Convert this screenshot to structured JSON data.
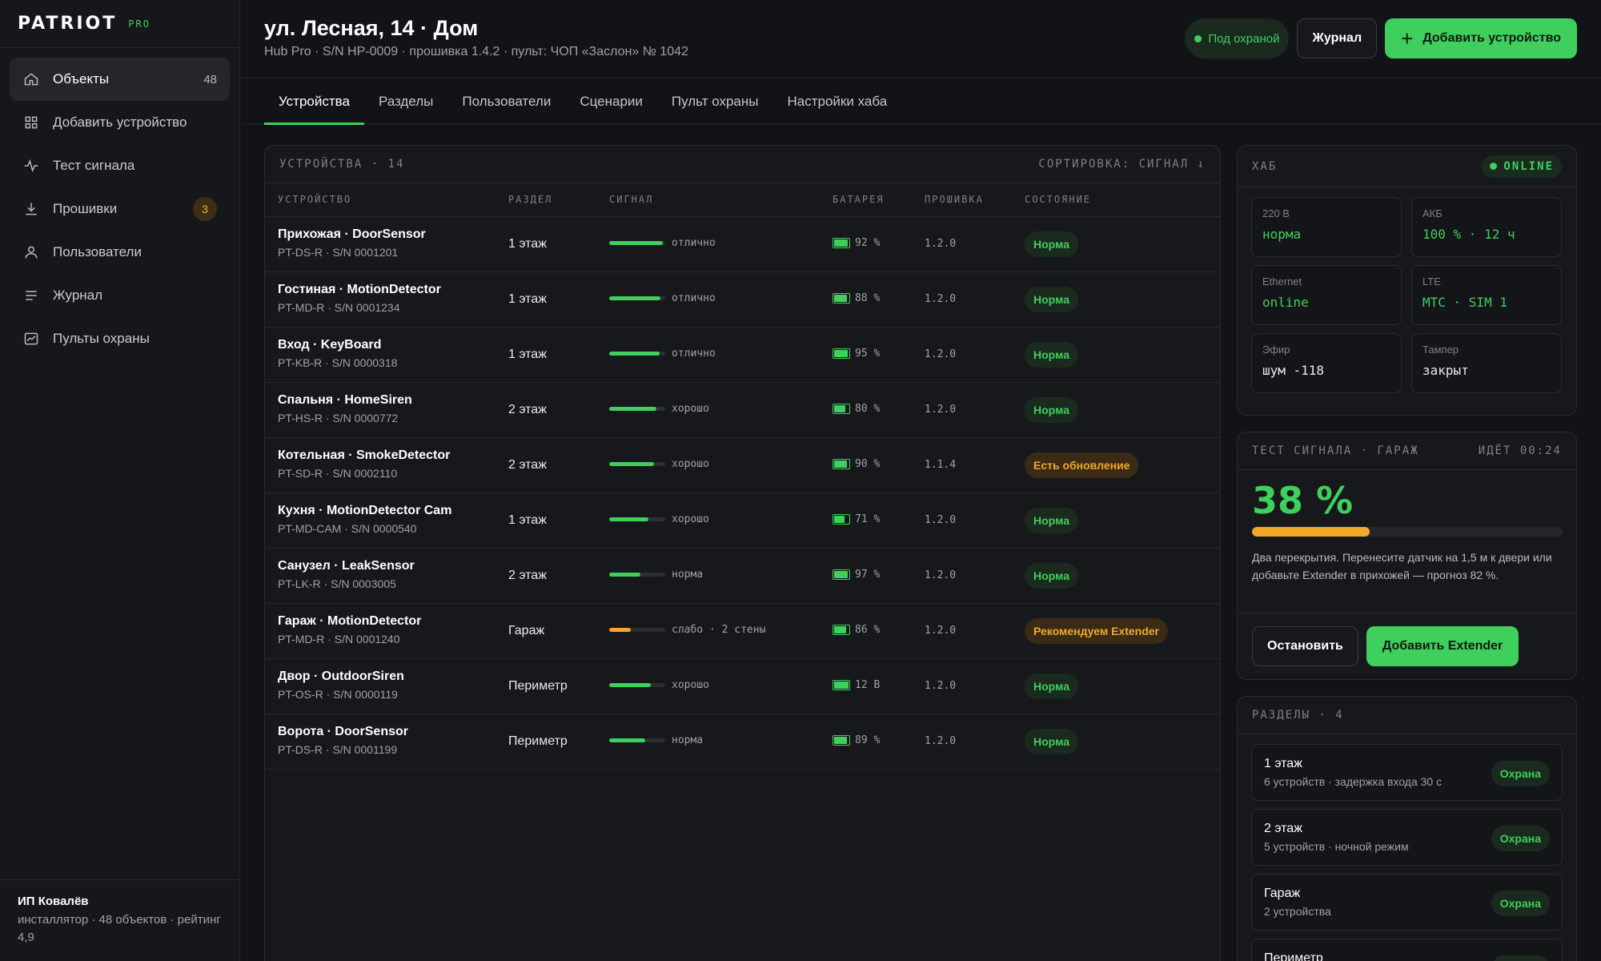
{
  "brand": {
    "name": "PATRIOT",
    "tag": "PRO"
  },
  "sidebar": {
    "items": [
      {
        "label": "Объекты",
        "count": "48",
        "icon": "home-icon"
      },
      {
        "label": "Добавить устройство",
        "icon": "grid-icon"
      },
      {
        "label": "Тест сигнала",
        "icon": "pulse-icon"
      },
      {
        "label": "Прошивки",
        "badge": "3",
        "icon": "download-icon"
      },
      {
        "label": "Пользователи",
        "icon": "user-icon"
      },
      {
        "label": "Журнал",
        "icon": "list-icon"
      },
      {
        "label": "Пульты охраны",
        "icon": "monitor-chart-icon"
      }
    ],
    "footer": {
      "name": "ИП Ковалёв",
      "meta": "инсталлятор · 48 объектов · рейтинг 4,9"
    }
  },
  "header": {
    "title": "ул. Лесная, 14 · Дом",
    "subtitle": "Hub Pro · S/N HP-0009 · прошивка 1.4.2 · пульт: ЧОП «Заслон» № 1042",
    "status": "Под охраной",
    "journal_label": "Журнал",
    "add_label": "Добавить устройство"
  },
  "tabs": [
    "Устройства",
    "Разделы",
    "Пользователи",
    "Сценарии",
    "Пульт охраны",
    "Настройки хаба"
  ],
  "devices": {
    "title": "УСТРОЙСТВА · 14",
    "sort": "СОРТИРОВКА: СИГНАЛ ↓",
    "columns": [
      "УСТРОЙСТВО",
      "РАЗДЕЛ",
      "СИГНАЛ",
      "БАТАРЕЯ",
      "ПРОШИВКА",
      "СОСТОЯНИЕ"
    ],
    "rows": [
      {
        "name": "Прихожая · DoorSensor",
        "sn": "PT-DS-R · S/N 0001201",
        "zone": "1 этаж",
        "signal": 0.96,
        "signal_color": "#3ecf5c",
        "signal_label": "отлично",
        "battery": 0.92,
        "battery_label": "92 %",
        "fw": "1.2.0",
        "state": "Норма",
        "state_kind": "ok"
      },
      {
        "name": "Гостиная · MotionDetector",
        "sn": "PT-MD-R · S/N 0001234",
        "zone": "1 этаж",
        "signal": 0.92,
        "signal_color": "#3ecf5c",
        "signal_label": "отлично",
        "battery": 0.88,
        "battery_label": "88 %",
        "fw": "1.2.0",
        "state": "Норма",
        "state_kind": "ok"
      },
      {
        "name": "Вход · KeyBoard",
        "sn": "PT-KB-R · S/N 0000318",
        "zone": "1 этаж",
        "signal": 0.9,
        "signal_color": "#3ecf5c",
        "signal_label": "отлично",
        "battery": 0.95,
        "battery_label": "95 %",
        "fw": "1.2.0",
        "state": "Норма",
        "state_kind": "ok"
      },
      {
        "name": "Спальня · HomeSiren",
        "sn": "PT-HS-R · S/N 0000772",
        "zone": "2 этаж",
        "signal": 0.84,
        "signal_color": "#3ecf5c",
        "signal_label": "хорошо",
        "battery": 0.8,
        "battery_label": "80 %",
        "fw": "1.2.0",
        "state": "Норма",
        "state_kind": "ok"
      },
      {
        "name": "Котельная · SmokeDetector",
        "sn": "PT-SD-R · S/N 0002110",
        "zone": "2 этаж",
        "signal": 0.8,
        "signal_color": "#3ecf5c",
        "signal_label": "хорошо",
        "battery": 0.9,
        "battery_label": "90 %",
        "fw": "1.1.4",
        "state": "Есть обновление",
        "state_kind": "warn"
      },
      {
        "name": "Кухня · MotionDetector Cam",
        "sn": "PT-MD-CAM · S/N 0000540",
        "zone": "1 этаж",
        "signal": 0.7,
        "signal_color": "#3ecf5c",
        "signal_label": "хорошо",
        "battery": 0.71,
        "battery_label": "71 %",
        "fw": "1.2.0",
        "state": "Норма",
        "state_kind": "ok"
      },
      {
        "name": "Санузел · LeakSensor",
        "sn": "PT-LK-R · S/N 0003005",
        "zone": "2 этаж",
        "signal": 0.56,
        "signal_color": "#3ecf5c",
        "signal_label": "норма",
        "battery": 0.97,
        "battery_label": "97 %",
        "fw": "1.2.0",
        "state": "Норма",
        "state_kind": "ok"
      },
      {
        "name": "Гараж · MotionDetector",
        "sn": "PT-MD-R · S/N 0001240",
        "zone": "Гараж",
        "signal": 0.38,
        "signal_color": "#f0a928",
        "signal_label": "слабо · 2 стены",
        "battery": 0.86,
        "battery_label": "86 %",
        "fw": "1.2.0",
        "state": "Рекомендуем Extender",
        "state_kind": "warn"
      },
      {
        "name": "Двор · OutdoorSiren",
        "sn": "PT-OS-R · S/N 0000119",
        "zone": "Периметр",
        "signal": 0.74,
        "signal_color": "#3ecf5c",
        "signal_label": "хорошо",
        "battery": 1.0,
        "battery_label": "12 В",
        "fw": "1.2.0",
        "state": "Норма",
        "state_kind": "ok"
      },
      {
        "name": "Ворота · DoorSensor",
        "sn": "PT-DS-R · S/N 0001199",
        "zone": "Периметр",
        "signal": 0.64,
        "signal_color": "#3ecf5c",
        "signal_label": "норма",
        "battery": 0.89,
        "battery_label": "89 %",
        "fw": "1.2.0",
        "state": "Норма",
        "state_kind": "ok"
      }
    ]
  },
  "hub": {
    "title": "ХАБ",
    "status": "ONLINE",
    "cells": [
      {
        "label": "220 В",
        "value": "норма",
        "green": true
      },
      {
        "label": "АКБ",
        "value": "100 % · 12 ч",
        "green": true
      },
      {
        "label": "Ethernet",
        "value": "online",
        "green": true
      },
      {
        "label": "LTE",
        "value": "МТС · SIM 1",
        "green": true
      },
      {
        "label": "Эфир",
        "value": "шум -118",
        "green": false
      },
      {
        "label": "Тампер",
        "value": "закрыт",
        "green": false
      }
    ]
  },
  "signal_test": {
    "title": "ТЕСТ СИГНАЛА · ГАРАЖ",
    "status": "ИДЁТ 00:24",
    "percent_label": "38 %",
    "progress": 0.38,
    "note": "Два перекрытия. Перенесите датчик на 1,5 м к двери или добавьте Extender в прихожей — прогноз 82 %.",
    "stop_label": "Остановить",
    "extender_label": "Добавить Extender"
  },
  "zones": {
    "title": "РАЗДЕЛЫ · 4",
    "items": [
      {
        "name": "1 этаж",
        "meta": "6 устройств · задержка входа 30 с",
        "state": "Охрана"
      },
      {
        "name": "2 этаж",
        "meta": "5 устройств · ночной режим",
        "state": "Охрана"
      },
      {
        "name": "Гараж",
        "meta": "2 устройства",
        "state": "Охрана"
      },
      {
        "name": "Периметр",
        "meta": "",
        "state": "Охрана"
      }
    ]
  }
}
